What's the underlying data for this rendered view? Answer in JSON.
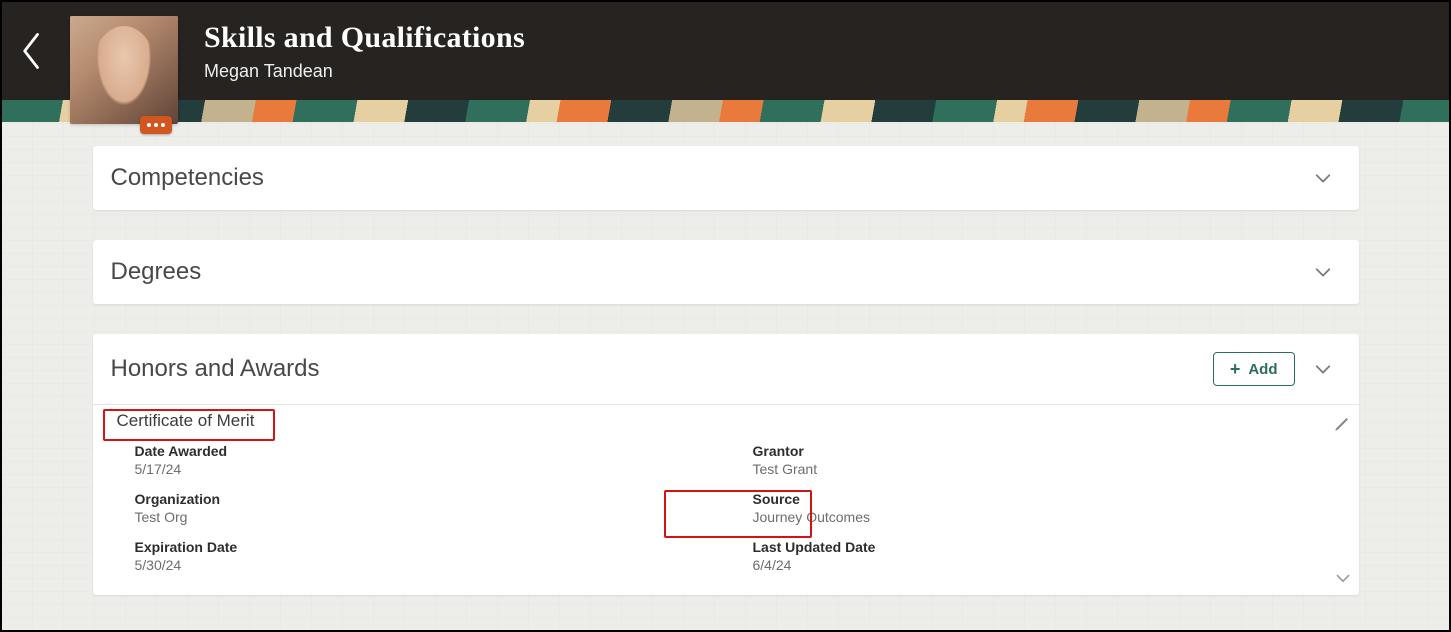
{
  "header": {
    "title": "Skills and Qualifications",
    "person_name": "Megan Tandean"
  },
  "sections": {
    "competencies": {
      "title": "Competencies",
      "expanded": false
    },
    "degrees": {
      "title": "Degrees",
      "expanded": false
    },
    "honors": {
      "title": "Honors and Awards",
      "expanded": true,
      "add_label": "Add",
      "items": [
        {
          "title": "Certificate of Merit",
          "date_awarded_label": "Date Awarded",
          "date_awarded": "5/17/24",
          "organization_label": "Organization",
          "organization": "Test Org",
          "expiration_label": "Expiration Date",
          "expiration": "5/30/24",
          "grantor_label": "Grantor",
          "grantor": "Test Grant",
          "source_label": "Source",
          "source": "Journey Outcomes",
          "last_updated_label": "Last Updated Date",
          "last_updated": "6/4/24"
        }
      ]
    }
  },
  "annotations": {
    "highlighted_item_title": true,
    "highlighted_source_field": true
  }
}
